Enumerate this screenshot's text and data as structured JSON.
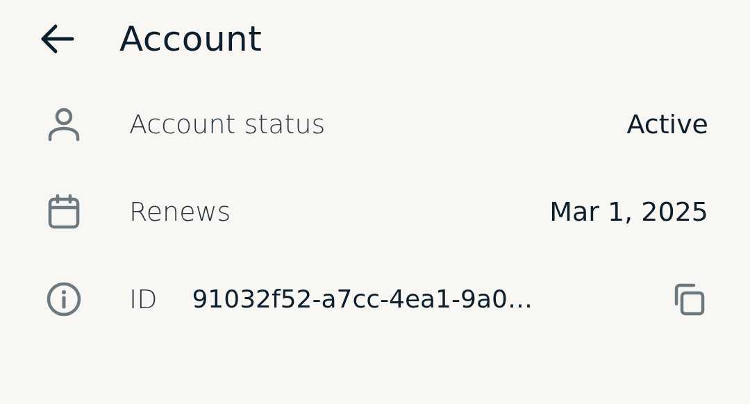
{
  "header": {
    "title": "Account"
  },
  "rows": [
    {
      "kind": "person",
      "label": "Account status",
      "value": "Active"
    },
    {
      "kind": "calendar",
      "label": "Renews",
      "value": "Mar 1, 2025"
    },
    {
      "kind": "id",
      "label": "ID",
      "value": "91032f52-a7cc-4ea1-9a0…"
    }
  ]
}
